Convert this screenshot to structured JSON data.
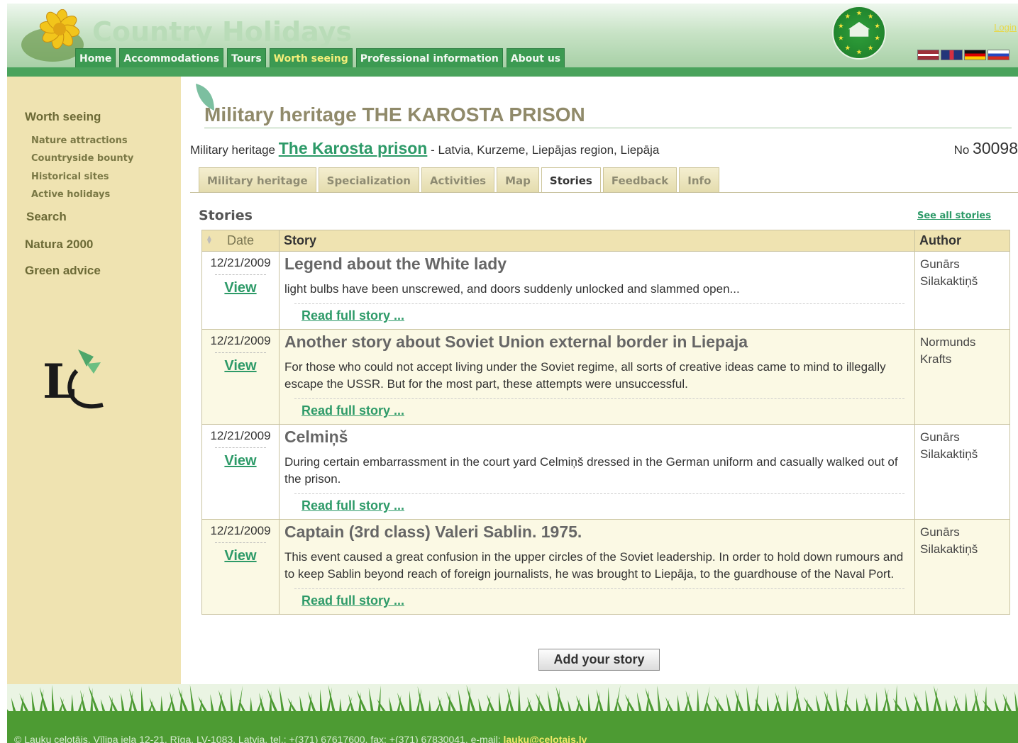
{
  "site": {
    "title": "Country Holidays",
    "login": "Login"
  },
  "nav": {
    "tabs": [
      "Home",
      "Accommodations",
      "Tours",
      "Worth seeing",
      "Professional information",
      "About us"
    ],
    "active": "Worth seeing"
  },
  "languages": [
    "Latvian",
    "English",
    "German",
    "Russian"
  ],
  "sidebar": {
    "worth_seeing": "Worth seeing",
    "subitems": [
      "Nature attractions",
      "Countryside bounty",
      "Historical sites",
      "Active holidays"
    ],
    "search": "Search",
    "natura": "Natura 2000",
    "green_advice": "Green advice"
  },
  "page": {
    "title": "Military heritage THE KAROSTA PRISON",
    "category": "Military heritage",
    "object_name": "The Karosta prison",
    "location": " - Latvia, Kurzeme, Liepājas region, Liepāja",
    "number_label": "No",
    "number": "30098"
  },
  "tabs": [
    "Military heritage",
    "Specialization",
    "Activities",
    "Map",
    "Stories",
    "Feedback",
    "Info"
  ],
  "active_tab": "Stories",
  "stories_section": {
    "title": "Stories",
    "see_all": "See all stories",
    "headers": {
      "date": "Date",
      "story": "Story",
      "author": "Author"
    },
    "view_label": "View",
    "read_more": "Read full story ...",
    "rows": [
      {
        "date": "12/21/2009",
        "title": "Legend about the White lady",
        "excerpt": "light bulbs have been unscrewed, and doors suddenly unlocked and slammed open...",
        "author": "Gunārs Silakaktiņš"
      },
      {
        "date": "12/21/2009",
        "title": "Another story about Soviet Union external border in Liepaja",
        "excerpt": "For those who could not accept living under the Soviet regime, all sorts of creative ideas came to mind to illegally escape the USSR. But for the most part, these attempts were unsuccessful.",
        "author": "Normunds Krafts"
      },
      {
        "date": "12/21/2009",
        "title": "Celmiņš",
        "excerpt": "During certain embarrassment in the court yard Celmiņš dressed in the German uniform and casually walked out of the prison.",
        "author": "Gunārs Silakaktiņš"
      },
      {
        "date": "12/21/2009",
        "title": "Captain (3rd class) Valeri Sablin. 1975.",
        "excerpt": "This event caused a great confusion in the upper circles of the Soviet leadership. In order to hold down rumours and to keep Sablin beyond reach of foreign journalists, he was brought to Liepāja, to the guardhouse of the Naval Port.",
        "author": "Gunārs Silakaktiņš"
      }
    ],
    "add_button": "Add your story"
  },
  "footer": {
    "text": "© Lauku ceļotājs, Vīlipa iela 12-21, Rīga, LV-1083, Latvia, tel.: +(371) 67617600, fax: +(371) 67830041, e-mail: ",
    "email": "lauku@celotajs.lv"
  },
  "colors": {
    "header_green": "#4aa35c",
    "sidebar_bg": "#efe3b1",
    "link_green": "#2d9a68",
    "title_gray": "#908a6a"
  }
}
